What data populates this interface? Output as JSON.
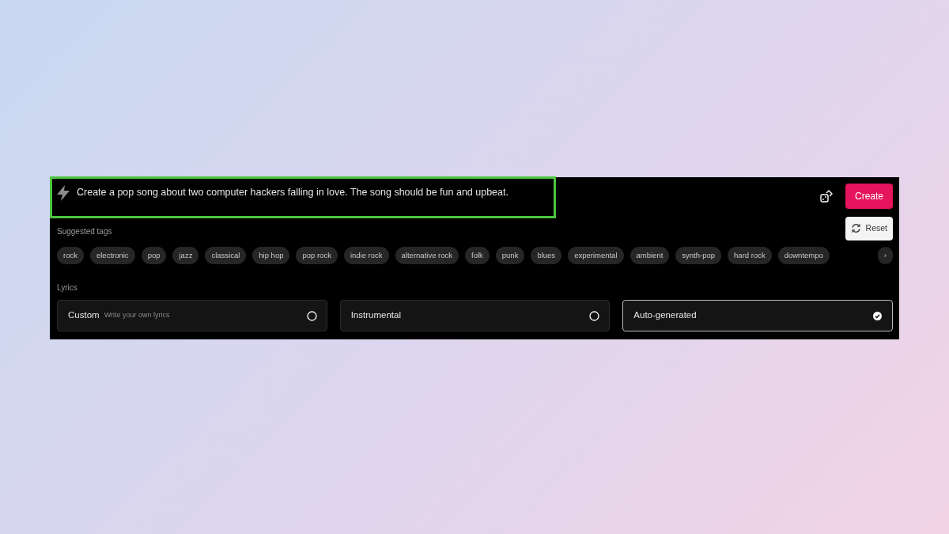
{
  "prompt": {
    "value": "Create a pop song about two computer hackers falling in love. The song should be fun and upbeat."
  },
  "create_button": "Create",
  "reset_button": "Reset",
  "suggested_tags": {
    "label": "Suggested tags",
    "tags": [
      "rock",
      "electronic",
      "pop",
      "jazz",
      "classical",
      "hip hop",
      "pop rock",
      "indie rock",
      "alternative rock",
      "folk",
      "punk",
      "blues",
      "experimental",
      "ambient",
      "synth-pop",
      "hard rock",
      "downtempo"
    ],
    "more": "›"
  },
  "lyrics": {
    "label": "Lyrics",
    "options": [
      {
        "label": "Custom",
        "description": "Write your own lyrics",
        "selected": false
      },
      {
        "label": "Instrumental",
        "selected": false
      },
      {
        "label": "Auto-generated",
        "selected": true
      }
    ]
  }
}
